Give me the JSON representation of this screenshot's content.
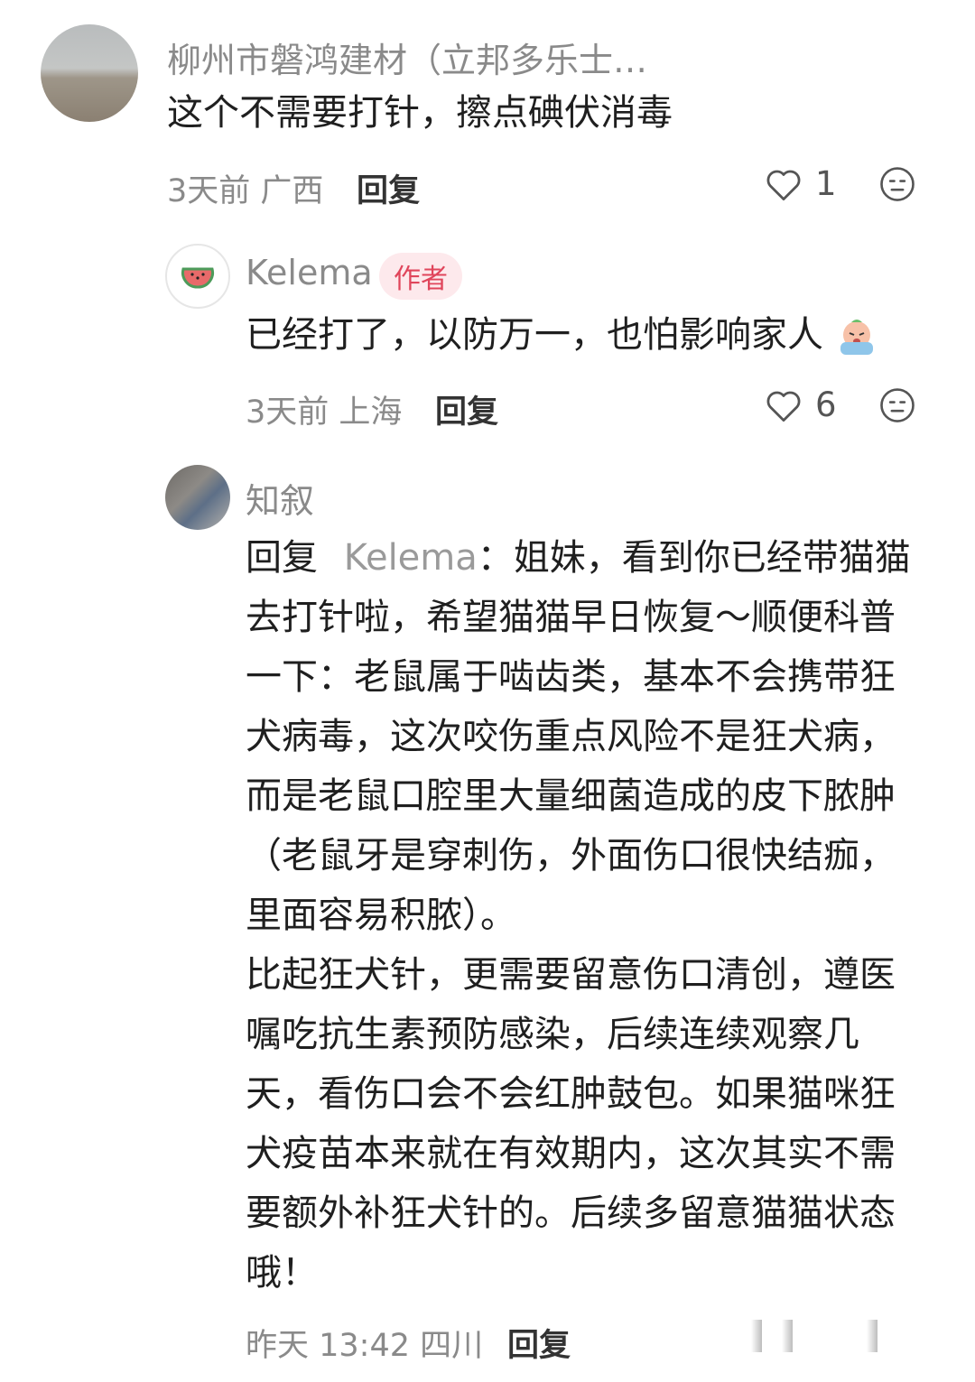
{
  "comments": [
    {
      "username": "柳州市磐鸿建材（立邦多乐士…",
      "text": "这个不需要打针，擦点碘伏消毒",
      "time_location": "3天前 广西",
      "reply_label": "回复",
      "likes": "1",
      "avatar_icon": "landscape-avatar-icon"
    },
    {
      "username": "Kelema",
      "badge": "作者",
      "text": "已经打了，以防万一，也怕影响家人",
      "emoji_icon": "crying-emoji-icon",
      "time_location": "3天前 上海",
      "reply_label": "回复",
      "likes": "6",
      "avatar_icon": "watermelon-avatar-icon"
    },
    {
      "username": "知叙",
      "reply_prefix": "回复",
      "mention": "Kelema",
      "colon": "：",
      "lines": [
        "姐妹，看到你已经带猫猫",
        "去打针啦，希望猫猫早日恢复～顺便科普",
        "一下：老鼠属于啮齿类，基本不会携带狂",
        "犬病毒，这次咬伤重点风险不是狂犬病，",
        "而是老鼠口腔里大量细菌造成的皮下脓肿",
        "（老鼠牙是穿刺伤，外面伤口很快结痂，",
        "里面容易积脓）。",
        "比起狂犬针，更需要留意伤口清创，遵医",
        "嘱吃抗生素预防感染，后续连续观察几",
        "天，看伤口会不会红肿鼓包。如果猫咪狂",
        "犬疫苗本来就在有效期内，这次其实不需",
        "要额外补狂犬针的。后续多留意猫猫状态",
        "哦！"
      ],
      "time_location": "昨天 13:42 四川",
      "reply_label": "回复",
      "avatar_icon": "person-photo-avatar-icon"
    }
  ],
  "colors": {
    "badge_bg": "#fde9ec",
    "badge_text": "#e0455b",
    "meta_gray": "#8a8a8a"
  }
}
